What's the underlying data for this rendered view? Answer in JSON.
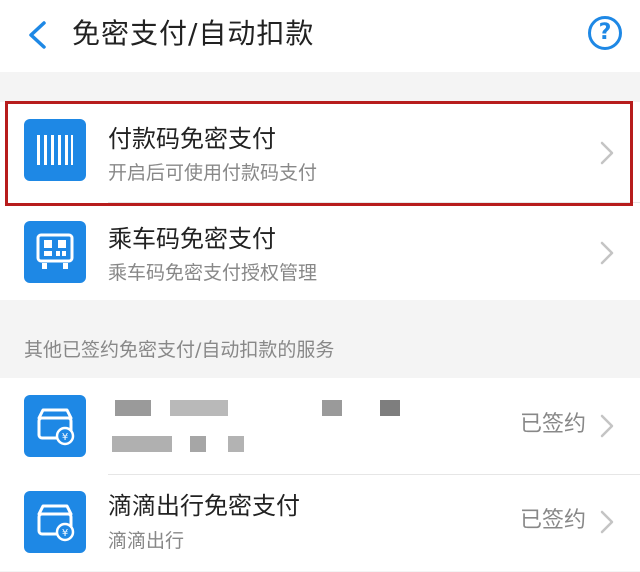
{
  "header": {
    "title": "免密支付/自动扣款",
    "help_label": "?"
  },
  "items": [
    {
      "title": "付款码免密支付",
      "subtitle": "开启后可使用付款码支付",
      "icon": "barcode-icon"
    },
    {
      "title": "乘车码免密支付",
      "subtitle": "乘车码免密支付授权管理",
      "icon": "qr-bus-icon"
    }
  ],
  "other_section": {
    "label": "其他已签约免密支付/自动扣款的服务",
    "services": [
      {
        "title": "",
        "subtitle": "",
        "status": "已签约",
        "icon": "merchant-icon",
        "redacted": true
      },
      {
        "title": "滴滴出行免密支付",
        "subtitle": "滴滴出行",
        "status": "已签约",
        "icon": "merchant-icon"
      }
    ]
  },
  "colors": {
    "accent": "#1e88e5",
    "highlight": "#b71c1c"
  }
}
